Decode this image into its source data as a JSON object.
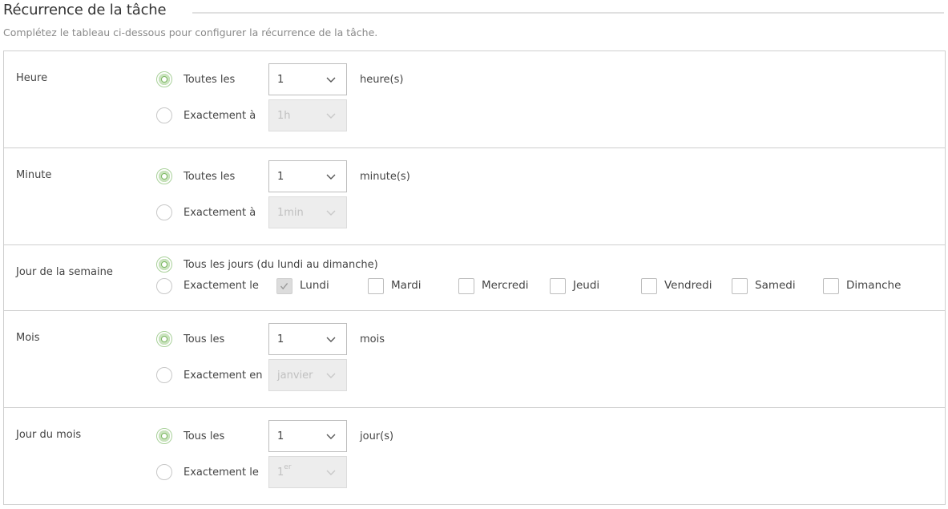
{
  "header": {
    "title": "Récurrence de la tâche",
    "subtitle": "Complétez le tableau ci-dessous pour configurer la récurrence de la tâche."
  },
  "rows": {
    "heure": {
      "label": "Heure",
      "every_label": "Toutes les",
      "every_value": "1",
      "unit": "heure(s)",
      "exact_label": "Exactement à",
      "exact_value": "1h",
      "selected": "every"
    },
    "minute": {
      "label": "Minute",
      "every_label": "Toutes les",
      "every_value": "1",
      "unit": "minute(s)",
      "exact_label": "Exactement à",
      "exact_value": "1min",
      "selected": "every"
    },
    "weekday": {
      "label": "Jour de la semaine",
      "every_label": "Tous les jours (du lundi au dimanche)",
      "exact_label": "Exactement le",
      "selected": "every",
      "days": [
        {
          "label": "Lundi",
          "checked": true
        },
        {
          "label": "Mardi",
          "checked": false
        },
        {
          "label": "Mercredi",
          "checked": false
        },
        {
          "label": "Jeudi",
          "checked": false
        },
        {
          "label": "Vendredi",
          "checked": false
        },
        {
          "label": "Samedi",
          "checked": false
        },
        {
          "label": "Dimanche",
          "checked": false
        }
      ]
    },
    "mois": {
      "label": "Mois",
      "every_label": "Tous les",
      "every_value": "1",
      "unit": "mois",
      "exact_label": "Exactement en",
      "exact_value": "janvier",
      "selected": "every"
    },
    "monthday": {
      "label": "Jour du mois",
      "every_label": "Tous les",
      "every_value": "1",
      "unit": "jour(s)",
      "exact_label": "Exactement le",
      "exact_value_base": "1",
      "exact_value_sup": "er",
      "selected": "every"
    }
  },
  "colors": {
    "radio_checked": "#7bb661",
    "border": "#cfcfcf",
    "disabled_bg": "#ededed"
  },
  "icons": {
    "select_arrow": "chevron-down-icon",
    "check": "check-icon"
  }
}
